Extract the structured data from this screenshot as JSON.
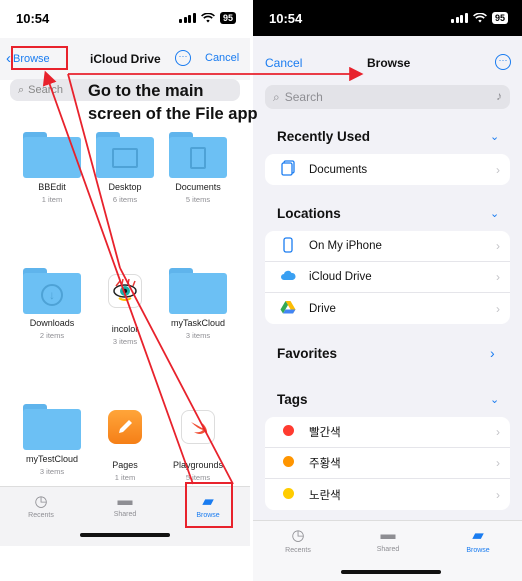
{
  "left": {
    "status": {
      "time": "10:54",
      "battery": "95"
    },
    "nav": {
      "back_label": "Browse",
      "title": "iCloud Drive",
      "cancel_label": "Cancel"
    },
    "search": {
      "placeholder": "Search"
    },
    "items": [
      {
        "name": "BBEdit",
        "sub": "1 item",
        "kind": "folder"
      },
      {
        "name": "Desktop",
        "sub": "6 items",
        "kind": "folder"
      },
      {
        "name": "Documents",
        "sub": "5 items",
        "kind": "folder"
      },
      {
        "name": "Downloads",
        "sub": "2 items",
        "kind": "folder"
      },
      {
        "name": "incolor",
        "sub": "3 items",
        "kind": "app"
      },
      {
        "name": "myTaskCloud",
        "sub": "3 items",
        "kind": "folder"
      },
      {
        "name": "myTestCloud",
        "sub": "3 items",
        "kind": "folder"
      },
      {
        "name": "Pages",
        "sub": "1 item",
        "kind": "app"
      },
      {
        "name": "Playgrounds",
        "sub": "5 items",
        "kind": "app"
      }
    ],
    "tabs": [
      {
        "label": "Recents",
        "icon": "clock-icon"
      },
      {
        "label": "Shared",
        "icon": "shared-folder-icon"
      },
      {
        "label": "Browse",
        "icon": "folder-icon",
        "active": true
      }
    ]
  },
  "annotation": {
    "text_line1": "Go to the main",
    "text_line2": "screen of the File app",
    "color": "#e8222c"
  },
  "right": {
    "status": {
      "time": "10:54",
      "battery": "95"
    },
    "nav": {
      "cancel_label": "Cancel",
      "title": "Browse"
    },
    "search": {
      "placeholder": "Search"
    },
    "sections": {
      "recently_used": {
        "title": "Recently Used",
        "rows": [
          {
            "label": "Documents",
            "icon": "document-icon"
          }
        ]
      },
      "locations": {
        "title": "Locations",
        "rows": [
          {
            "label": "On My iPhone",
            "icon": "iphone-icon"
          },
          {
            "label": "iCloud Drive",
            "icon": "cloud-icon"
          },
          {
            "label": "Drive",
            "icon": "google-drive-icon"
          }
        ]
      },
      "favorites": {
        "title": "Favorites"
      },
      "tags": {
        "title": "Tags",
        "rows": [
          {
            "label": "빨간색",
            "color": "#ff3b30"
          },
          {
            "label": "주황색",
            "color": "#ff9500"
          },
          {
            "label": "노란색",
            "color": "#ffcc00"
          }
        ]
      }
    },
    "tabs": [
      {
        "label": "Recents",
        "icon": "clock-icon"
      },
      {
        "label": "Shared",
        "icon": "shared-folder-icon"
      },
      {
        "label": "Browse",
        "icon": "folder-icon",
        "active": true
      }
    ]
  }
}
